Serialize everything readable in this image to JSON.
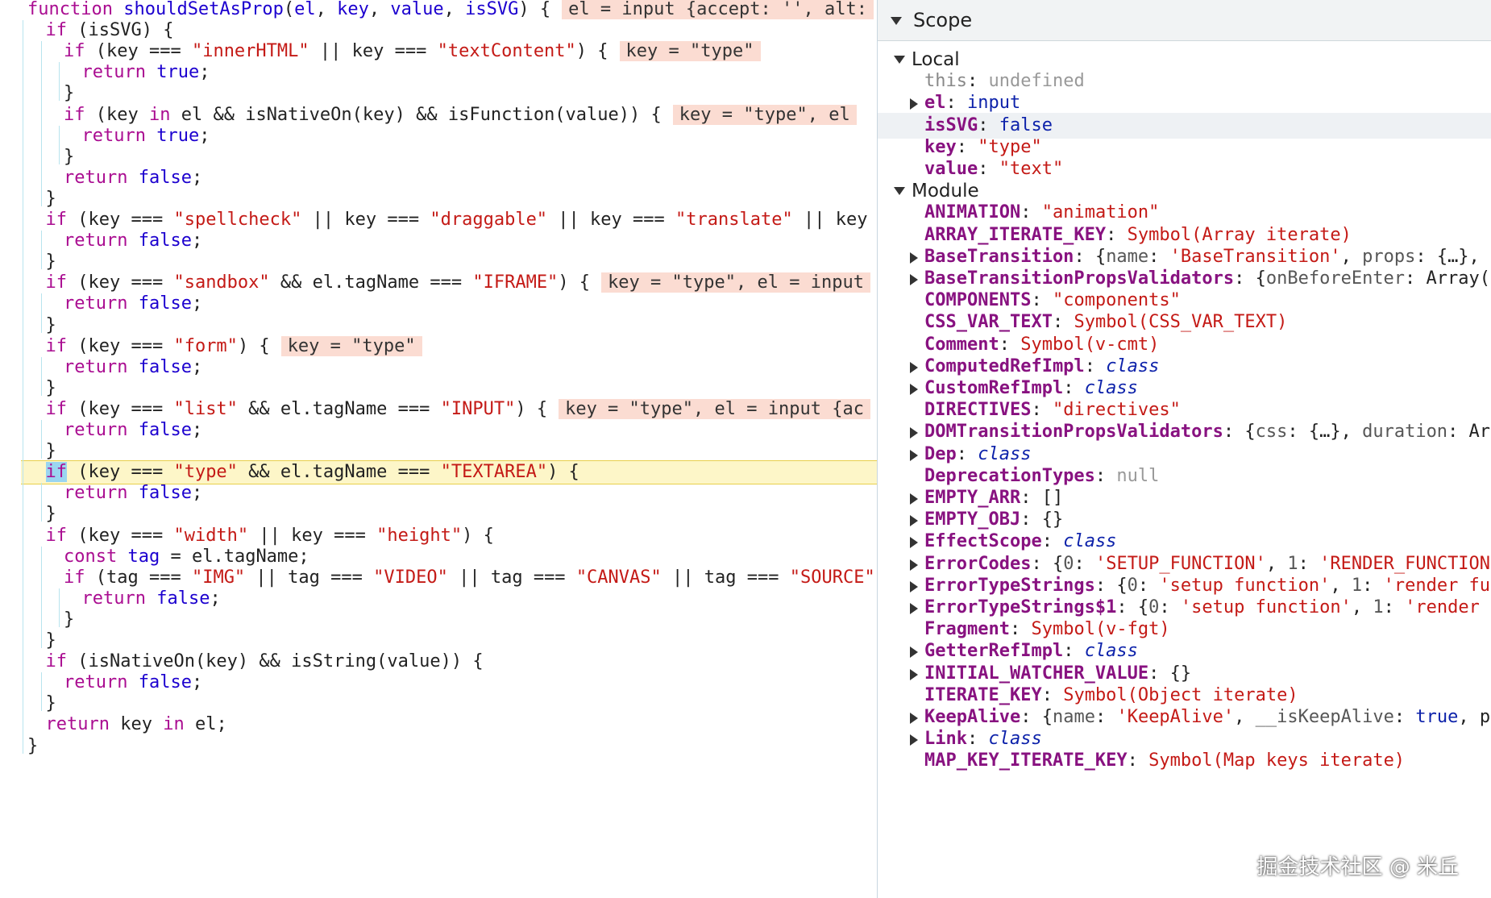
{
  "code": {
    "lines": [
      {
        "tokens": [
          [
            "kw",
            "function "
          ],
          [
            "fn",
            "shouldSetAsProp"
          ],
          [
            "plain",
            "("
          ],
          [
            "prm",
            "el"
          ],
          [
            "plain",
            ", "
          ],
          [
            "prm",
            "key"
          ],
          [
            "plain",
            ", "
          ],
          [
            "prm",
            "value"
          ],
          [
            "plain",
            ", "
          ],
          [
            "prm",
            "isSVG"
          ],
          [
            "plain",
            ") {"
          ]
        ],
        "indent": 0,
        "inline": "el = input {accept: '', alt:"
      },
      {
        "tokens": [
          [
            "kw",
            "if"
          ],
          [
            "plain",
            " (isSVG) {"
          ]
        ],
        "indent": 1
      },
      {
        "tokens": [
          [
            "kw",
            "if"
          ],
          [
            "plain",
            " (key === "
          ],
          [
            "str",
            "\"innerHTML\""
          ],
          [
            "plain",
            " || key === "
          ],
          [
            "str",
            "\"textContent\""
          ],
          [
            "plain",
            ") {"
          ]
        ],
        "indent": 2,
        "inline": "key = \"type\""
      },
      {
        "tokens": [
          [
            "kw",
            "return "
          ],
          [
            "fn",
            "true"
          ],
          [
            "plain",
            ";"
          ]
        ],
        "indent": 3
      },
      {
        "tokens": [
          [
            "plain",
            "}"
          ]
        ],
        "indent": 2
      },
      {
        "tokens": [
          [
            "kw",
            "if"
          ],
          [
            "plain",
            " (key "
          ],
          [
            "kw",
            "in"
          ],
          [
            "plain",
            " el && isNativeOn(key) && isFunction(value)) {"
          ]
        ],
        "indent": 2,
        "inline": "key = \"type\", el"
      },
      {
        "tokens": [
          [
            "kw",
            "return "
          ],
          [
            "fn",
            "true"
          ],
          [
            "plain",
            ";"
          ]
        ],
        "indent": 3
      },
      {
        "tokens": [
          [
            "plain",
            "}"
          ]
        ],
        "indent": 2
      },
      {
        "tokens": [
          [
            "kw",
            "return "
          ],
          [
            "fn",
            "false"
          ],
          [
            "plain",
            ";"
          ]
        ],
        "indent": 2
      },
      {
        "tokens": [
          [
            "plain",
            "}"
          ]
        ],
        "indent": 1
      },
      {
        "tokens": [
          [
            "kw",
            "if"
          ],
          [
            "plain",
            " (key === "
          ],
          [
            "str",
            "\"spellcheck\""
          ],
          [
            "plain",
            " || key === "
          ],
          [
            "str",
            "\"draggable\""
          ],
          [
            "plain",
            " || key === "
          ],
          [
            "str",
            "\"translate\""
          ],
          [
            "plain",
            " || key"
          ]
        ],
        "indent": 1
      },
      {
        "tokens": [
          [
            "kw",
            "return "
          ],
          [
            "fn",
            "false"
          ],
          [
            "plain",
            ";"
          ]
        ],
        "indent": 2
      },
      {
        "tokens": [
          [
            "plain",
            "}"
          ]
        ],
        "indent": 1
      },
      {
        "tokens": [
          [
            "kw",
            "if"
          ],
          [
            "plain",
            " (key === "
          ],
          [
            "str",
            "\"sandbox\""
          ],
          [
            "plain",
            " && el.tagName === "
          ],
          [
            "str",
            "\"IFRAME\""
          ],
          [
            "plain",
            ") {"
          ]
        ],
        "indent": 1,
        "inline": "key = \"type\", el = input"
      },
      {
        "tokens": [
          [
            "kw",
            "return "
          ],
          [
            "fn",
            "false"
          ],
          [
            "plain",
            ";"
          ]
        ],
        "indent": 2
      },
      {
        "tokens": [
          [
            "plain",
            "}"
          ]
        ],
        "indent": 1
      },
      {
        "tokens": [
          [
            "kw",
            "if"
          ],
          [
            "plain",
            " (key === "
          ],
          [
            "str",
            "\"form\""
          ],
          [
            "plain",
            ") {"
          ]
        ],
        "indent": 1,
        "inline": "key = \"type\""
      },
      {
        "tokens": [
          [
            "kw",
            "return "
          ],
          [
            "fn",
            "false"
          ],
          [
            "plain",
            ";"
          ]
        ],
        "indent": 2
      },
      {
        "tokens": [
          [
            "plain",
            "}"
          ]
        ],
        "indent": 1
      },
      {
        "tokens": [
          [
            "kw",
            "if"
          ],
          [
            "plain",
            " (key === "
          ],
          [
            "str",
            "\"list\""
          ],
          [
            "plain",
            " && el.tagName === "
          ],
          [
            "str",
            "\"INPUT\""
          ],
          [
            "plain",
            ") {"
          ]
        ],
        "indent": 1,
        "inline": "key = \"type\", el = input {ac"
      },
      {
        "tokens": [
          [
            "kw",
            "return "
          ],
          [
            "fn",
            "false"
          ],
          [
            "plain",
            ";"
          ]
        ],
        "indent": 2
      },
      {
        "tokens": [
          [
            "plain",
            "}"
          ]
        ],
        "indent": 1
      },
      {
        "tokens": [
          [
            "bp",
            "if"
          ],
          [
            "plain",
            " (key === "
          ],
          [
            "str",
            "\"type\""
          ],
          [
            "plain",
            " && el.tagName === "
          ],
          [
            "str",
            "\"TEXTAREA\""
          ],
          [
            "plain",
            ") {"
          ]
        ],
        "indent": 1,
        "current": true
      },
      {
        "tokens": [
          [
            "kw",
            "return "
          ],
          [
            "fn",
            "false"
          ],
          [
            "plain",
            ";"
          ]
        ],
        "indent": 2
      },
      {
        "tokens": [
          [
            "plain",
            "}"
          ]
        ],
        "indent": 1
      },
      {
        "tokens": [
          [
            "kw",
            "if"
          ],
          [
            "plain",
            " (key === "
          ],
          [
            "str",
            "\"width\""
          ],
          [
            "plain",
            " || key === "
          ],
          [
            "str",
            "\"height\""
          ],
          [
            "plain",
            ") {"
          ]
        ],
        "indent": 1
      },
      {
        "tokens": [
          [
            "kw",
            "const "
          ],
          [
            "prm",
            "tag"
          ],
          [
            "plain",
            " = el.tagName;"
          ]
        ],
        "indent": 2
      },
      {
        "tokens": [
          [
            "kw",
            "if"
          ],
          [
            "plain",
            " (tag === "
          ],
          [
            "str",
            "\"IMG\""
          ],
          [
            "plain",
            " || tag === "
          ],
          [
            "str",
            "\"VIDEO\""
          ],
          [
            "plain",
            " || tag === "
          ],
          [
            "str",
            "\"CANVAS\""
          ],
          [
            "plain",
            " || tag === "
          ],
          [
            "str",
            "\"SOURCE\""
          ]
        ],
        "indent": 2
      },
      {
        "tokens": [
          [
            "kw",
            "return "
          ],
          [
            "fn",
            "false"
          ],
          [
            "plain",
            ";"
          ]
        ],
        "indent": 3
      },
      {
        "tokens": [
          [
            "plain",
            "}"
          ]
        ],
        "indent": 2
      },
      {
        "tokens": [
          [
            "plain",
            "}"
          ]
        ],
        "indent": 1
      },
      {
        "tokens": [
          [
            "kw",
            "if"
          ],
          [
            "plain",
            " (isNativeOn(key) && isString(value)) {"
          ]
        ],
        "indent": 1
      },
      {
        "tokens": [
          [
            "kw",
            "return "
          ],
          [
            "fn",
            "false"
          ],
          [
            "plain",
            ";"
          ]
        ],
        "indent": 2
      },
      {
        "tokens": [
          [
            "plain",
            "}"
          ]
        ],
        "indent": 1
      },
      {
        "tokens": [
          [
            "kw",
            "return "
          ],
          [
            "plain",
            "key "
          ],
          [
            "kw",
            "in"
          ],
          [
            "plain",
            " el;"
          ]
        ],
        "indent": 1
      },
      {
        "tokens": [
          [
            "plain",
            "}"
          ]
        ],
        "indent": 0
      }
    ]
  },
  "scope": {
    "title": "Scope",
    "rows": [
      {
        "type": "section",
        "label": "Local",
        "expanded": true,
        "level": 1
      },
      {
        "level": 2,
        "key": "this",
        "val": [
          [
            "v-grey",
            "undefined"
          ]
        ],
        "keyPlain": true
      },
      {
        "level": 2,
        "key": "el",
        "val": [
          [
            "v-kw",
            "input"
          ]
        ],
        "expandable": true
      },
      {
        "level": 2,
        "key": "isSVG",
        "val": [
          [
            "v-kw",
            "false"
          ]
        ],
        "selected": true
      },
      {
        "level": 2,
        "key": "key",
        "val": [
          [
            "v-str",
            "\"type\""
          ]
        ]
      },
      {
        "level": 2,
        "key": "value",
        "val": [
          [
            "v-str",
            "\"text\""
          ]
        ]
      },
      {
        "type": "section",
        "label": "Module",
        "expanded": true,
        "level": 1
      },
      {
        "level": 2,
        "key": "ANIMATION",
        "val": [
          [
            "v-str",
            "\"animation\""
          ]
        ]
      },
      {
        "level": 2,
        "key": "ARRAY_ITERATE_KEY",
        "val": [
          [
            "v-str",
            "Symbol(Array iterate)"
          ]
        ]
      },
      {
        "level": 2,
        "key": "BaseTransition",
        "expandable": true,
        "val": [
          [
            "v-plain",
            "{"
          ],
          [
            "v-prop",
            "name"
          ],
          [
            "v-plain",
            ": "
          ],
          [
            "v-str",
            "'BaseTransition'"
          ],
          [
            "v-plain",
            ", "
          ],
          [
            "v-prop",
            "props"
          ],
          [
            "v-plain",
            ": {…},"
          ]
        ]
      },
      {
        "level": 2,
        "key": "BaseTransitionPropsValidators",
        "expandable": true,
        "val": [
          [
            "v-plain",
            "{"
          ],
          [
            "v-prop",
            "onBeforeEnter"
          ],
          [
            "v-plain",
            ": Array("
          ]
        ]
      },
      {
        "level": 2,
        "key": "COMPONENTS",
        "val": [
          [
            "v-str",
            "\"components\""
          ]
        ]
      },
      {
        "level": 2,
        "key": "CSS_VAR_TEXT",
        "val": [
          [
            "v-str",
            "Symbol(CSS_VAR_TEXT)"
          ]
        ]
      },
      {
        "level": 2,
        "key": "Comment",
        "val": [
          [
            "v-str",
            "Symbol(v-cmt)"
          ]
        ]
      },
      {
        "level": 2,
        "key": "ComputedRefImpl",
        "expandable": true,
        "val": [
          [
            "v-cls",
            "class"
          ]
        ]
      },
      {
        "level": 2,
        "key": "CustomRefImpl",
        "expandable": true,
        "val": [
          [
            "v-cls",
            "class"
          ]
        ]
      },
      {
        "level": 2,
        "key": "DIRECTIVES",
        "val": [
          [
            "v-str",
            "\"directives\""
          ]
        ]
      },
      {
        "level": 2,
        "key": "DOMTransitionPropsValidators",
        "expandable": true,
        "val": [
          [
            "v-plain",
            "{"
          ],
          [
            "v-prop",
            "css"
          ],
          [
            "v-plain",
            ": {…}, "
          ],
          [
            "v-prop",
            "duration"
          ],
          [
            "v-plain",
            ": Ar"
          ]
        ]
      },
      {
        "level": 2,
        "key": "Dep",
        "expandable": true,
        "val": [
          [
            "v-cls",
            "class"
          ]
        ]
      },
      {
        "level": 2,
        "key": "DeprecationTypes",
        "val": [
          [
            "v-grey",
            "null"
          ]
        ]
      },
      {
        "level": 2,
        "key": "EMPTY_ARR",
        "expandable": true,
        "val": [
          [
            "v-plain",
            "[]"
          ]
        ]
      },
      {
        "level": 2,
        "key": "EMPTY_OBJ",
        "expandable": true,
        "val": [
          [
            "v-plain",
            "{}"
          ]
        ]
      },
      {
        "level": 2,
        "key": "EffectScope",
        "expandable": true,
        "val": [
          [
            "v-cls",
            "class"
          ]
        ]
      },
      {
        "level": 2,
        "key": "ErrorCodes",
        "expandable": true,
        "val": [
          [
            "v-plain",
            "{"
          ],
          [
            "v-prop",
            "0"
          ],
          [
            "v-plain",
            ": "
          ],
          [
            "v-str",
            "'SETUP_FUNCTION'"
          ],
          [
            "v-plain",
            ", "
          ],
          [
            "v-prop",
            "1"
          ],
          [
            "v-plain",
            ": "
          ],
          [
            "v-str",
            "'RENDER_FUNCTION"
          ]
        ]
      },
      {
        "level": 2,
        "key": "ErrorTypeStrings",
        "expandable": true,
        "val": [
          [
            "v-plain",
            "{"
          ],
          [
            "v-prop",
            "0"
          ],
          [
            "v-plain",
            ": "
          ],
          [
            "v-str",
            "'setup function'"
          ],
          [
            "v-plain",
            ", "
          ],
          [
            "v-prop",
            "1"
          ],
          [
            "v-plain",
            ": "
          ],
          [
            "v-str",
            "'render fu"
          ]
        ]
      },
      {
        "level": 2,
        "key": "ErrorTypeStrings$1",
        "expandable": true,
        "val": [
          [
            "v-plain",
            "{"
          ],
          [
            "v-prop",
            "0"
          ],
          [
            "v-plain",
            ": "
          ],
          [
            "v-str",
            "'setup function'"
          ],
          [
            "v-plain",
            ", "
          ],
          [
            "v-prop",
            "1"
          ],
          [
            "v-plain",
            ": "
          ],
          [
            "v-str",
            "'render"
          ]
        ]
      },
      {
        "level": 2,
        "key": "Fragment",
        "val": [
          [
            "v-str",
            "Symbol(v-fgt)"
          ]
        ]
      },
      {
        "level": 2,
        "key": "GetterRefImpl",
        "expandable": true,
        "val": [
          [
            "v-cls",
            "class"
          ]
        ]
      },
      {
        "level": 2,
        "key": "INITIAL_WATCHER_VALUE",
        "expandable": true,
        "val": [
          [
            "v-plain",
            "{}"
          ]
        ]
      },
      {
        "level": 2,
        "key": "ITERATE_KEY",
        "val": [
          [
            "v-str",
            "Symbol(Object iterate)"
          ]
        ]
      },
      {
        "level": 2,
        "key": "KeepAlive",
        "expandable": true,
        "val": [
          [
            "v-plain",
            "{"
          ],
          [
            "v-prop",
            "name"
          ],
          [
            "v-plain",
            ": "
          ],
          [
            "v-str",
            "'KeepAlive'"
          ],
          [
            "v-plain",
            ", "
          ],
          [
            "v-prop",
            "__isKeepAlive"
          ],
          [
            "v-plain",
            ": "
          ],
          [
            "v-kw",
            "true"
          ],
          [
            "v-plain",
            ", p"
          ]
        ]
      },
      {
        "level": 2,
        "key": "Link",
        "expandable": true,
        "val": [
          [
            "v-cls",
            "class"
          ]
        ]
      },
      {
        "level": 2,
        "key": "MAP_KEY_ITERATE_KEY",
        "val": [
          [
            "v-str",
            "Symbol(Map keys iterate)"
          ]
        ]
      }
    ]
  },
  "watermark": "掘金技术社区 @ 米丘"
}
